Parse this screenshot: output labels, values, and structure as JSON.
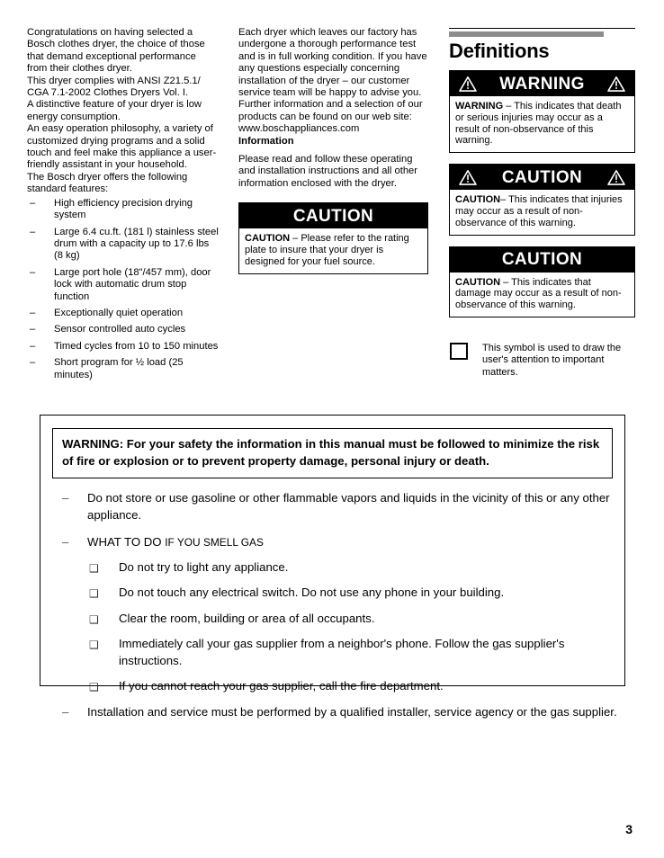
{
  "column1": {
    "paragraphs": [
      "Congratulations on having selected a Bosch clothes dryer, the choice of those that demand exceptional performance from their clothes dryer.",
      "This dryer complies with ANSI Z21.5.1/ CGA 7.1-2002 Clothes Dryers Vol. I.",
      "A distinctive feature of your dryer is low energy consumption.",
      "An easy operation philosophy, a variety of customized drying programs and a solid touch and feel make this appliance a user-friendly assistant in your household.",
      "The Bosch dryer offers the following standard features:"
    ],
    "features": [
      "High efficiency precision drying system",
      "Large 6.4 cu.ft. (181 l) stainless steel drum with a capacity up to 17.6 lbs (8 kg)",
      "Large port hole (18\"/457 mm), door lock with automatic drum stop function",
      "Exceptionally quiet operation",
      "Sensor controlled auto cycles",
      "Timed cycles from 10 to 150 minutes",
      "Short program for ½ load (25 minutes)"
    ],
    "dash": "–"
  },
  "column2": {
    "paragraphs": [
      "Each dryer which leaves our factory has undergone a thorough performance test and is in full working condition. If you have any questions especially concerning installation of the dryer – our customer service team will be happy to advise you.",
      "Further information and a selection of our products can be found on our web site:",
      "www.boschappliances.com"
    ],
    "information_heading": "Information",
    "information_text": "Please read and follow these operating and installation instructions and all other information enclosed with the dryer.",
    "caution_box": {
      "title": "CAUTION",
      "lead": "CAUTION",
      "text": " – Please refer to the rating plate to insure that your dryer is designed for your fuel source."
    }
  },
  "column3": {
    "title": "Definitions",
    "boxes": [
      {
        "title": "WARNING",
        "icons": true,
        "lead": "WARNING",
        "text": " – This indicates that death or serious injuries may occur as a result of non-observance of this warning."
      },
      {
        "title": "CAUTION",
        "icons": true,
        "lead": "CAUTION",
        "text": "– This indicates that injuries may occur as a result of non-observance of this warning."
      },
      {
        "title": "CAUTION",
        "icons": false,
        "lead": "CAUTION",
        "text": " – This indicates that damage may occur as a result of non-observance of this warning."
      }
    ],
    "symbol_note": "This symbol is used to draw the user's attention to important matters."
  },
  "bottom_warning": {
    "headline": "WARNING: For your safety the information in this manual must be followed to minimize the risk of fire or explosion or to prevent property damage, personal injury or death.",
    "dash": "–",
    "box_bullet": "❑",
    "items": [
      {
        "text": "Do not store or use gasoline or other flammable vapors and liquids in the vicinity of this or any other appliance."
      },
      {
        "heading_lead": "WHAT TO DO ",
        "heading_rest": "IF YOU SMELL GAS",
        "sub_items": [
          "Do not try to light any appliance.",
          "Do not touch any electrical switch. Do not use any phone in your building.",
          "Clear the room, building or area of all occupants.",
          "Immediately call your gas supplier from a neighbor's phone. Follow the gas supplier's instructions.",
          "If you cannot reach your gas supplier, call the fire department."
        ]
      },
      {
        "text": "Installation and service must be performed by a qualified installer, service agency or the gas supplier."
      }
    ]
  },
  "page_number": "3",
  "colors": {
    "banner_background": "#000000",
    "banner_text": "#ffffff",
    "rule_gray": "#8c8c8c",
    "body_text": "#000000"
  }
}
